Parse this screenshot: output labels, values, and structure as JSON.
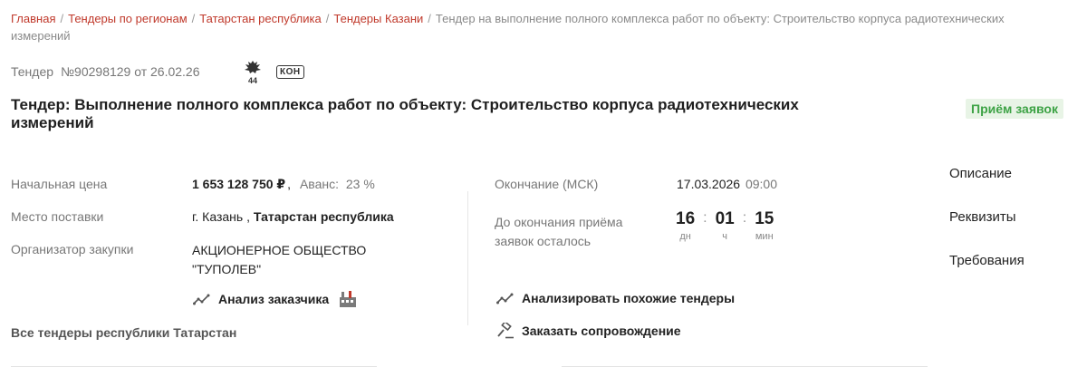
{
  "breadcrumb": {
    "items": [
      "Главная",
      "Тендеры по регионам",
      "Татарстан республика",
      "Тендеры Казани"
    ],
    "current": "Тендер на выполнение полного комплекса работ по объекту: Строительство корпуса радиотехнических измерений"
  },
  "tender": {
    "label": "Тендер",
    "number": "№90298129 от 26.02.26",
    "law_icon_text": "44",
    "type_badge": "КОН",
    "title": "Тендер: Выполнение полного комплекса работ по объекту: Строительство корпуса радиотехнических измерений",
    "status": "Приём заявок"
  },
  "details": {
    "price_label": "Начальная цена",
    "price_value": "1 653 128 750 ₽",
    "advance_label": "Аванс:",
    "advance_value": "23 %",
    "delivery_label": "Место поставки",
    "delivery_city": "г. Казань",
    "delivery_region": "Татарстан республика",
    "organizer_label": "Организатор закупки",
    "organizer_value": "АКЦИОНЕРНОЕ ОБЩЕСТВО \"ТУПОЛЕВ\"",
    "customer_analysis": "Анализ заказчика",
    "all_region_tenders": "Все тендеры республики Татарстан"
  },
  "deadline": {
    "end_label": "Окончание (МСК)",
    "end_date": "17.03.2026",
    "end_time": "09:00",
    "remaining_label": "До окончания приёма заявок осталось",
    "days": "16",
    "days_cap": "дн",
    "hours": "01",
    "hours_cap": "ч",
    "minutes": "15",
    "minutes_cap": "мин",
    "similar_action": "Анализировать похожие тендеры",
    "support_action": "Заказать сопровождение"
  },
  "side_nav": [
    "Описание",
    "Реквизиты",
    "Требования"
  ],
  "colors": {
    "link": "#c0392b",
    "status_bg": "#e8f4e6",
    "status_text": "#3ea346"
  }
}
